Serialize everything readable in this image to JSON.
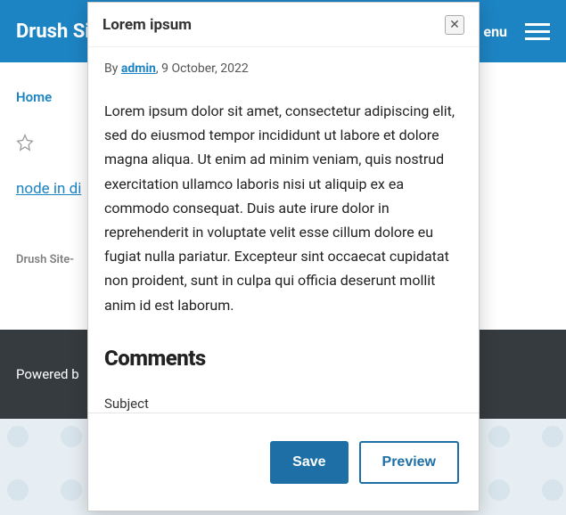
{
  "header": {
    "site_title": "Drush Sit",
    "menu_label": "enu"
  },
  "page": {
    "breadcrumb_home": "Home",
    "node_link": "node in di",
    "footer_site": "Drush Site-",
    "powered_by": "Powered b"
  },
  "dialog": {
    "title": "Lorem ipsum",
    "by_prefix": "By ",
    "author": "admin",
    "date_sep": ", ",
    "date": "9 October, 2022",
    "body": "Lorem ipsum dolor sit amet, consectetur adipiscing elit, sed do eiusmod tempor incididunt ut labore et dolore magna aliqua. Ut enim ad minim veniam, quis nostrud exercitation ullamco laboris nisi ut aliquip ex ea commodo consequat. Duis aute irure dolor in reprehenderit in voluptate velit esse cillum dolore eu fugiat nulla pariatur. Excepteur sint occaecat cupidatat non proident, sunt in culpa qui officia deserunt mollit anim id est laborum.",
    "comments_heading": "Comments",
    "subject_label": "Subject",
    "save_label": "Save",
    "preview_label": "Preview"
  }
}
